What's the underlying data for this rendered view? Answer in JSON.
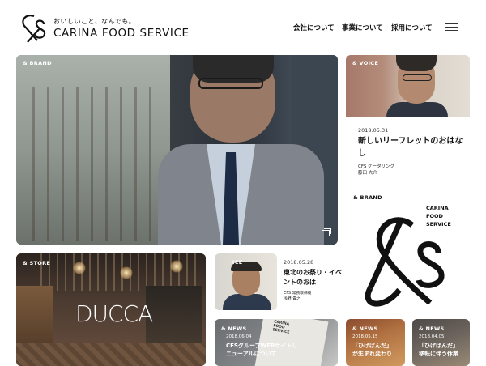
{
  "header": {
    "logo_label": "cfs",
    "tagline": "おいしいこと、なんでも。",
    "brand": "CARINA FOOD SERVICE",
    "nav": [
      "会社について",
      "事業について",
      "採用について"
    ]
  },
  "hero": {
    "tag": "& BRAND"
  },
  "voice_card": {
    "tag": "& VOICE",
    "date": "2018.05.31",
    "title": "新しいリーフレットのおはなし",
    "meta_line1": "CFS ケータリング",
    "meta_line2": "藤田 大介"
  },
  "brand_panel": {
    "tag": "& BRAND",
    "name_line1": "CARINA",
    "name_line2": "FOOD",
    "name_line3": "SERVICE"
  },
  "store": {
    "tag": "& STORE",
    "name": "DUCCA"
  },
  "voice2": {
    "tag": "ICE",
    "date": "2018.05.28",
    "title": "東北のお祭り・イベントのおは",
    "meta_line1": "CFS 常務取締役",
    "meta_line2": "浅野 貴之"
  },
  "news": [
    {
      "tag": "& NEWS",
      "date": "2018.06.04",
      "title_line1": "CFSグループWEBサイトリ",
      "title_line2": "ニューアルについて"
    },
    {
      "tag": "& NEWS",
      "date": "2018.05.15",
      "title_line1": "「ひげばんだ」",
      "title_line2": "が生まれ変わり"
    },
    {
      "tag": "& NEWS",
      "date": "2018.04.05",
      "title_line1": "「ひげばんだ」",
      "title_line2": "移転に伴う休業"
    }
  ],
  "pamphlet_text": [
    "CARINA",
    "FOOD",
    "SERVICE"
  ],
  "colors": {
    "text": "#111111",
    "background": "#ffffff"
  }
}
